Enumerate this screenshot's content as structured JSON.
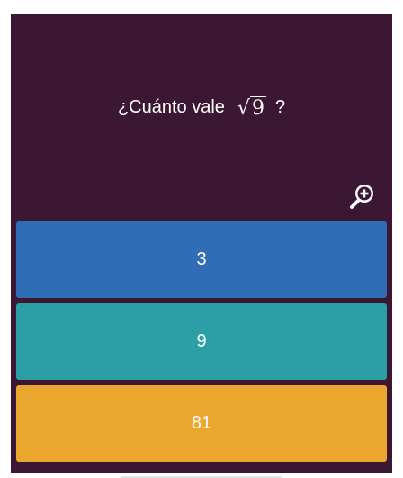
{
  "question": {
    "prefix": "¿Cuánto vale",
    "radical_symbol": "√",
    "radicand": "9",
    "suffix": "?"
  },
  "zoom": {
    "icon": "zoom-in-icon"
  },
  "options": [
    {
      "label": "3",
      "color": "#2f6db4"
    },
    {
      "label": "9",
      "color": "#2b9ea6"
    },
    {
      "label": "81",
      "color": "#eba72d"
    }
  ],
  "colors": {
    "background": "#3c1734",
    "text": "#ffffff"
  }
}
